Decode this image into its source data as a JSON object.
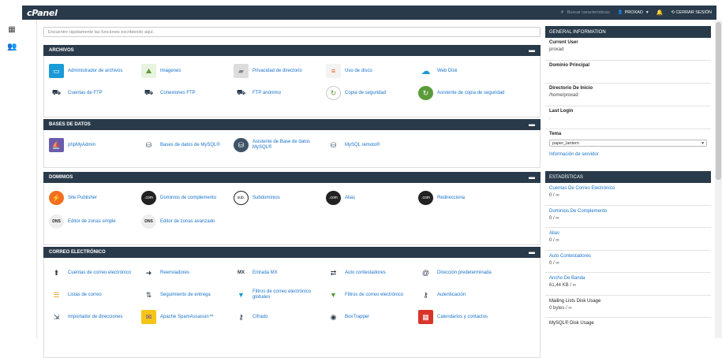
{
  "app": {
    "logo": "cPanel"
  },
  "topbar": {
    "search_placeholder": "Buscar características",
    "user": "PROXAD",
    "logout": "CERRAR SESIÓN"
  },
  "main": {
    "search_placeholder": "Encuentre rápidamente las funciones escribiendo aquí."
  },
  "sections": {
    "archivos": {
      "title": "ARCHIVOS",
      "items": [
        "Administrador de archivos",
        "Imágenes",
        "Privacidad de directorio",
        "Uso de disco",
        "Web Disk",
        "Cuentas de FTP",
        "Conexiones FTP",
        "FTP anónimo",
        "Copia de seguridad",
        "Asistente de copia de seguridad"
      ]
    },
    "bases": {
      "title": "BASES DE DATOS",
      "items": [
        "phpMyAdmin",
        "Bases de datos de MySQL®",
        "Asistente de Base de datos MySQL®",
        "MySQL remoto®"
      ]
    },
    "dominios": {
      "title": "DOMINIOS",
      "items": [
        "Site Publisher",
        "Dominios de complemento",
        "Subdominios",
        "Alias",
        "Redirecciona",
        "Editor de zonas simple",
        "Editor de zonas avanzado"
      ]
    },
    "correo": {
      "title": "CORREO ELECTRÓNICO",
      "items": [
        "Cuentas de correo electrónico",
        "Reenviadores",
        "Entrada MX",
        "Auto contestadores",
        "Dirección predeterminada",
        "Listas de correo",
        "Seguimiento de entrega",
        "Filtros de correo electrónico globales",
        "Filtros de correo electrónico",
        "Autenticación",
        "Importador de direcciones",
        "Apache SpamAssassin™",
        "Cifrado",
        "BoxTrapper",
        "Calendarios y contactos"
      ]
    }
  },
  "general": {
    "title": "GENERAL INFORMATION",
    "current_user_label": "Current User",
    "current_user": "proxad",
    "dominio_label": "Dominio Principal",
    "dominio": "",
    "dir_label": "Directorio De Inicio",
    "dir": "/home/proxad",
    "last_login_label": "Last Login",
    "last_login": ".",
    "tema_label": "Tema",
    "tema": "paper_lantern",
    "server_info": "Información de servidor"
  },
  "stats": {
    "title": "ESTADÍSTICAS",
    "rows": [
      {
        "label": "Cuentas De Correo Electrónico",
        "value": "0 / ∞"
      },
      {
        "label": "Dominios De Complemento",
        "value": "0 / ∞"
      },
      {
        "label": "Alias",
        "value": "0 / ∞"
      },
      {
        "label": "Auto Contestadores",
        "value": "0 / ∞"
      },
      {
        "label": "Ancho De Banda",
        "value": "61,44 KB / ∞"
      },
      {
        "label": "Mailing Lists Disk Usage",
        "value": "0 bytes / ∞"
      },
      {
        "label": "MySQL® Disk Usage",
        "value": ""
      }
    ]
  }
}
